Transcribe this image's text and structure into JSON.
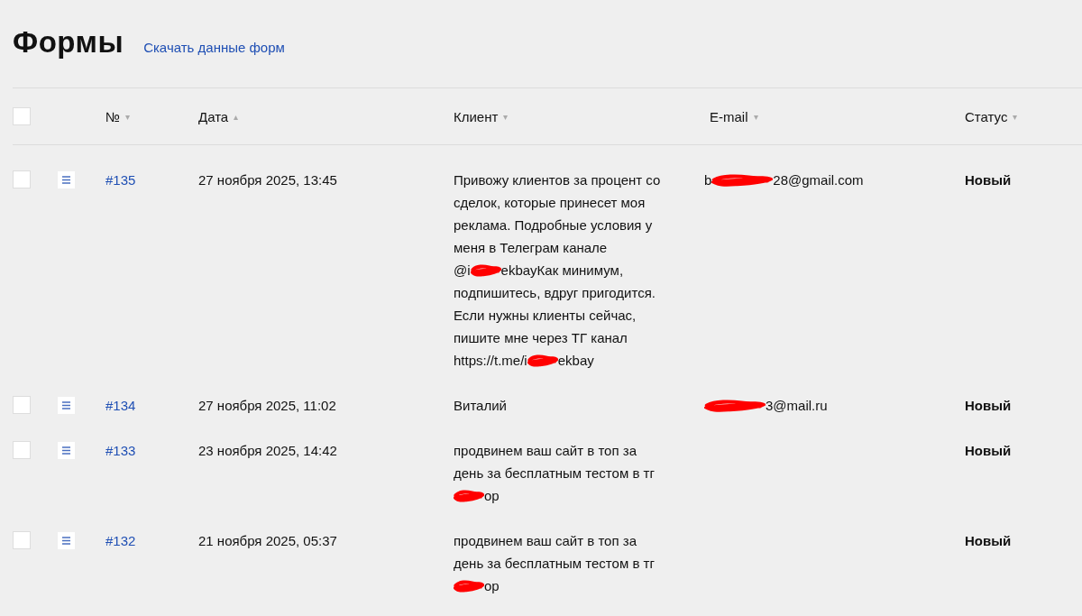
{
  "title": "Формы",
  "download_link": "Скачать данные форм",
  "table": {
    "select_all": {
      "checked": false
    },
    "columns": [
      {
        "label": "№",
        "sort_arrow": "▾"
      },
      {
        "label": "Дата",
        "sort_arrow": "▴"
      },
      {
        "label": "Клиент",
        "sort_arrow": "▾"
      },
      {
        "label": "E-mail",
        "sort_arrow": "▾"
      },
      {
        "label": "Статус",
        "sort_arrow": "▾"
      }
    ],
    "rows": [
      {
        "checked": false,
        "number": "#135",
        "date": "27 ноября 2025, 13:45",
        "client_lines": [
          [
            {
              "kind": "text",
              "text": "Привожу клиентов за процент со"
            }
          ],
          [
            {
              "kind": "text",
              "text": "сделок, которые принесет моя"
            }
          ],
          [
            {
              "kind": "text",
              "text": "реклама. Подробные условия у"
            }
          ],
          [
            {
              "kind": "text",
              "text": "меня в Телеграм канале"
            }
          ],
          [
            {
              "kind": "text",
              "text": "@i"
            },
            {
              "kind": "redaction"
            },
            {
              "kind": "text",
              "text": "ekbayКак минимум,"
            }
          ],
          [
            {
              "kind": "text",
              "text": "подпишитесь, вдруг пригодится."
            }
          ],
          [
            {
              "kind": "text",
              "text": "Если нужны клиенты сейчас,"
            }
          ],
          [
            {
              "kind": "text",
              "text": "пишите мне через ТГ канал"
            }
          ],
          [
            {
              "kind": "text",
              "text": "https://t.me/i"
            },
            {
              "kind": "redaction"
            },
            {
              "kind": "text",
              "text": "ekbay"
            }
          ]
        ],
        "email": [
          {
            "kind": "text",
            "text": "b"
          },
          {
            "kind": "redaction"
          },
          {
            "kind": "text",
            "text": "28@gmail.com"
          }
        ],
        "status": "Новый"
      },
      {
        "checked": false,
        "number": "#134",
        "date": "27 ноября 2025, 11:02",
        "client_lines": [
          [
            {
              "kind": "text",
              "text": "Виталий"
            }
          ]
        ],
        "email": [
          {
            "kind": "redaction"
          },
          {
            "kind": "text",
            "text": "3@mail.ru"
          }
        ],
        "status": "Новый"
      },
      {
        "checked": false,
        "number": "#133",
        "date": "23 ноября 2025, 14:42",
        "client_lines": [
          [
            {
              "kind": "text",
              "text": "продвинем ваш сайт в топ за"
            }
          ],
          [
            {
              "kind": "text",
              "text": "день за бесплатным тестом в тг"
            }
          ],
          [
            {
              "kind": "redaction"
            },
            {
              "kind": "text",
              "text": "ор"
            }
          ]
        ],
        "status": "Новый"
      },
      {
        "checked": false,
        "number": "#132",
        "date": "21 ноября 2025, 05:37",
        "client_lines": [
          [
            {
              "kind": "text",
              "text": "продвинем ваш сайт в топ за"
            }
          ],
          [
            {
              "kind": "text",
              "text": "день за бесплатным тестом в тг"
            }
          ],
          [
            {
              "kind": "redaction"
            },
            {
              "kind": "text",
              "text": "ор"
            }
          ]
        ],
        "status": "Новый"
      }
    ]
  }
}
